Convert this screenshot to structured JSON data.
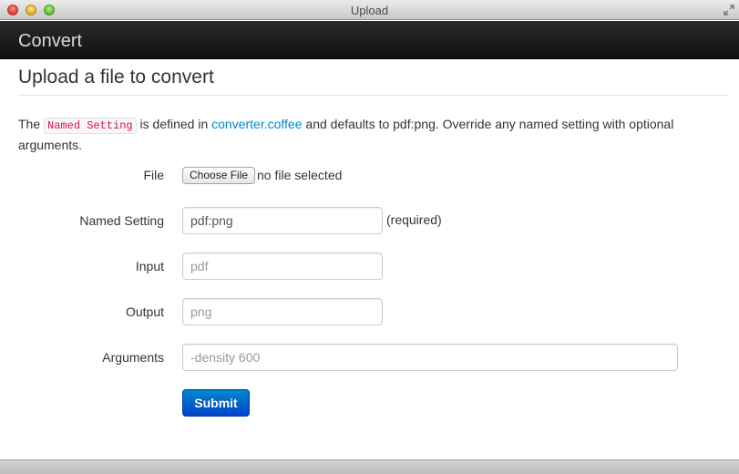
{
  "window": {
    "title": "Upload"
  },
  "navbar": {
    "brand": "Convert"
  },
  "page": {
    "title": "Upload a file to convert",
    "intro": {
      "prefix": "The ",
      "code": "Named Setting",
      "middle": " is defined in ",
      "link": "converter.coffee",
      "suffix": " and defaults to pdf:png. Override any named setting with optional arguments."
    }
  },
  "form": {
    "file": {
      "label": "File",
      "button": "Choose File",
      "status": "no file selected"
    },
    "named_setting": {
      "label": "Named Setting",
      "value": "pdf:png",
      "note": "(required)"
    },
    "input": {
      "label": "Input",
      "placeholder": "pdf"
    },
    "output": {
      "label": "Output",
      "placeholder": "png"
    },
    "arguments": {
      "label": "Arguments",
      "placeholder": "-density 600"
    },
    "submit": "Submit"
  },
  "colors": {
    "navbar": "#1b1b1b",
    "link": "#0088cc",
    "code": "#dd1144",
    "primary_button": "#0055cc"
  },
  "icons": {
    "close": "red-traffic-light",
    "minimize": "yellow-traffic-light",
    "zoom": "green-traffic-light",
    "fullscreen": "fullscreen-arrows-icon"
  }
}
